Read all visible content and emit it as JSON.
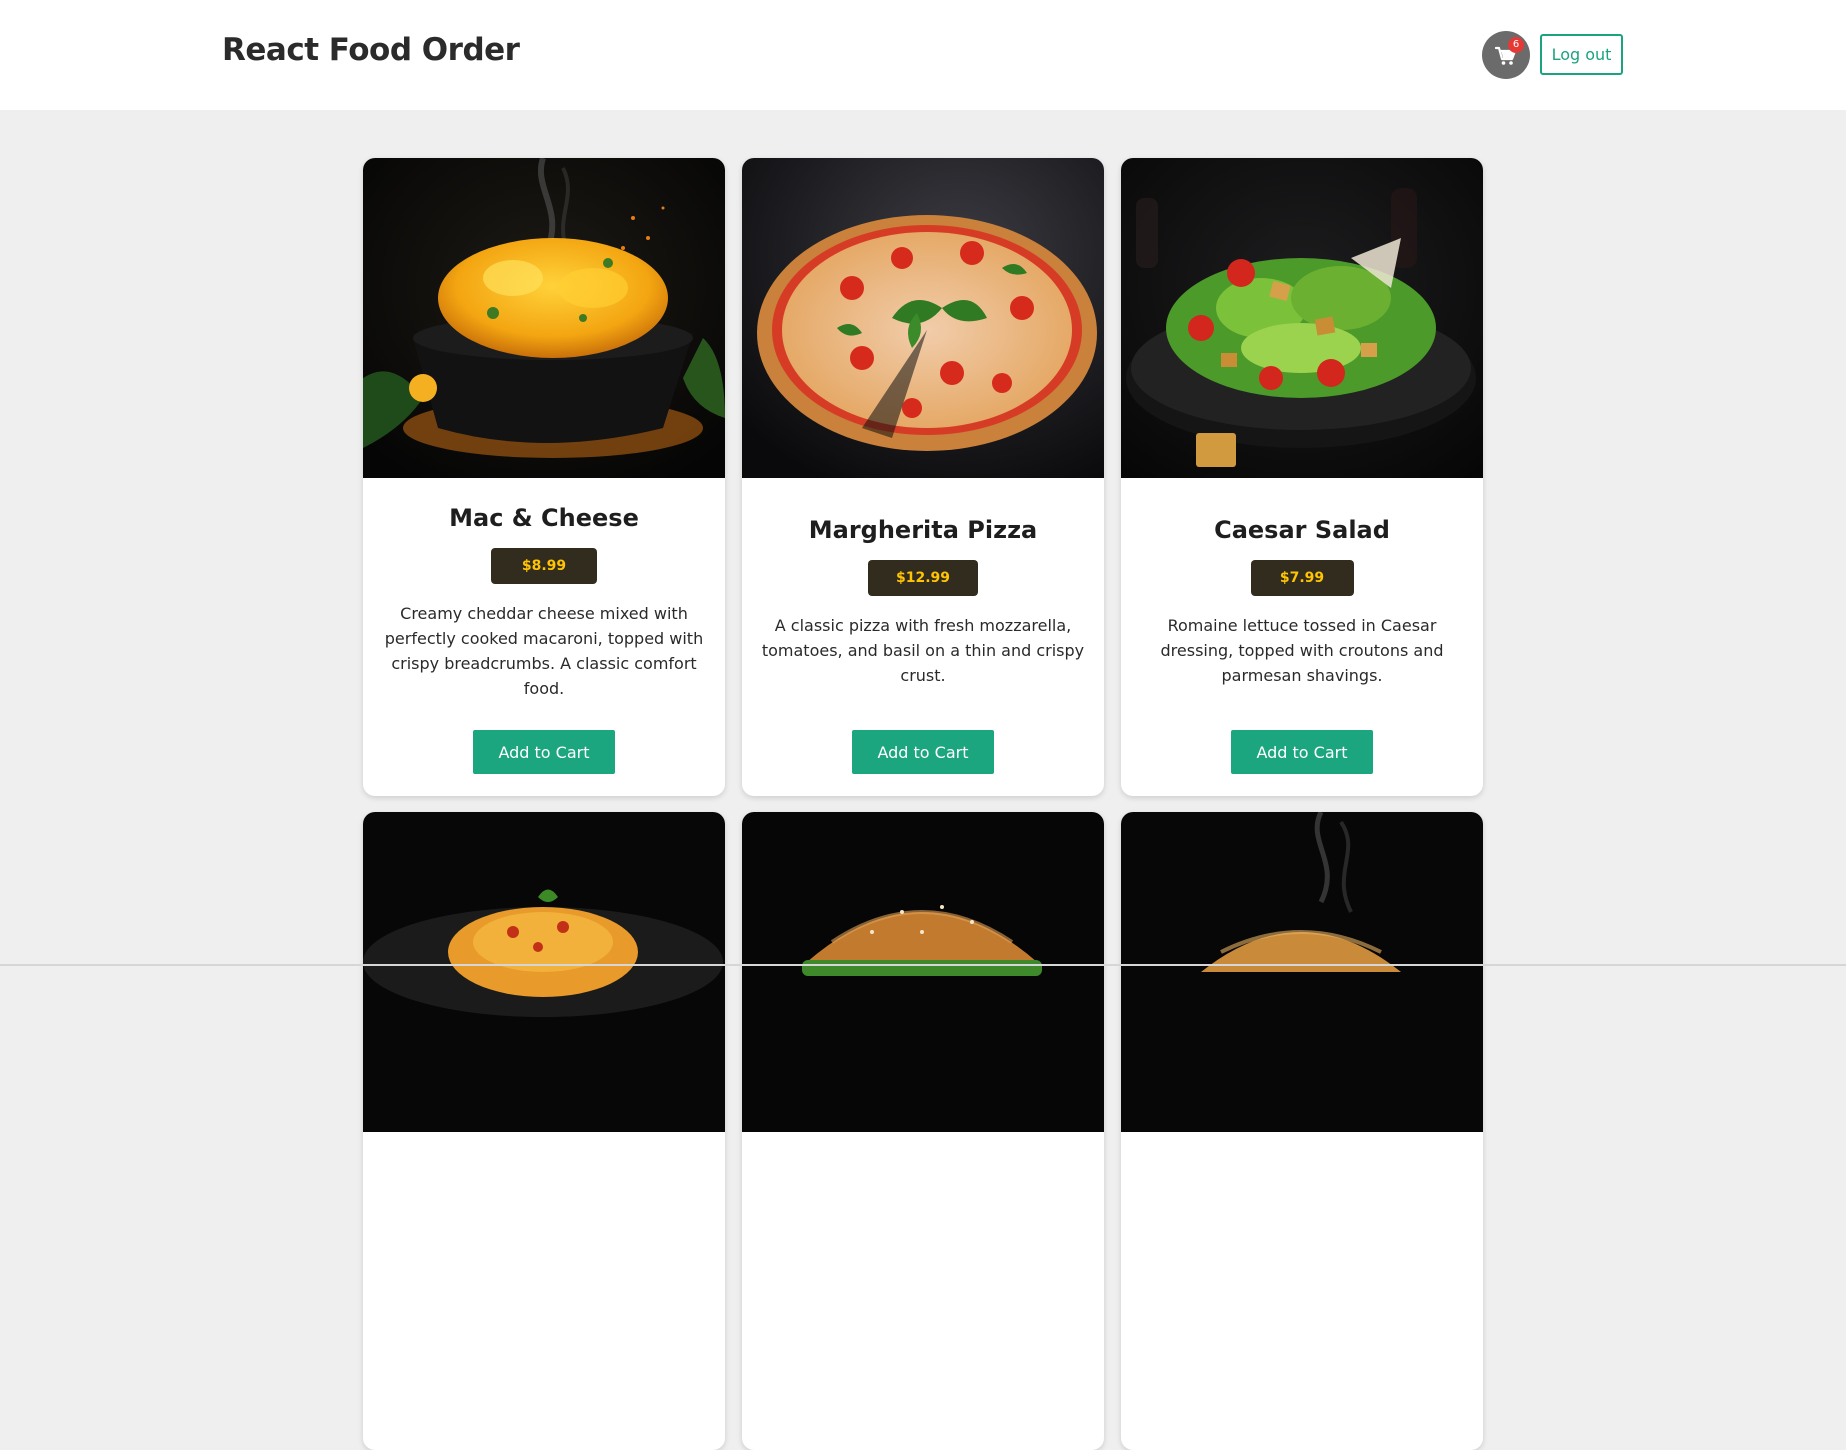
{
  "header": {
    "title": "React Food Order",
    "cart_count": "6",
    "cart_icon": "shopping-cart-icon",
    "logout_label": "Log out"
  },
  "colors": {
    "accent": "#1ca67f",
    "price_bg": "#312c1d",
    "price_text": "#ffc404",
    "cart_bg": "#6b6b6b",
    "badge": "#e53935"
  },
  "meals": [
    {
      "name": "Mac & Cheese",
      "price": "$8.99",
      "description": "Creamy cheddar cheese mixed with perfectly cooked macaroni, topped with crispy breadcrumbs. A classic comfort food.",
      "button": "Add to Cart"
    },
    {
      "name": "Margherita Pizza",
      "price": "$12.99",
      "description": "A classic pizza with fresh mozzarella, tomatoes, and basil on a thin and crispy crust.",
      "button": "Add to Cart"
    },
    {
      "name": "Caesar Salad",
      "price": "$7.99",
      "description": "Romaine lettuce tossed in Caesar dressing, topped with croutons and parmesan shavings.",
      "button": "Add to Cart"
    }
  ]
}
